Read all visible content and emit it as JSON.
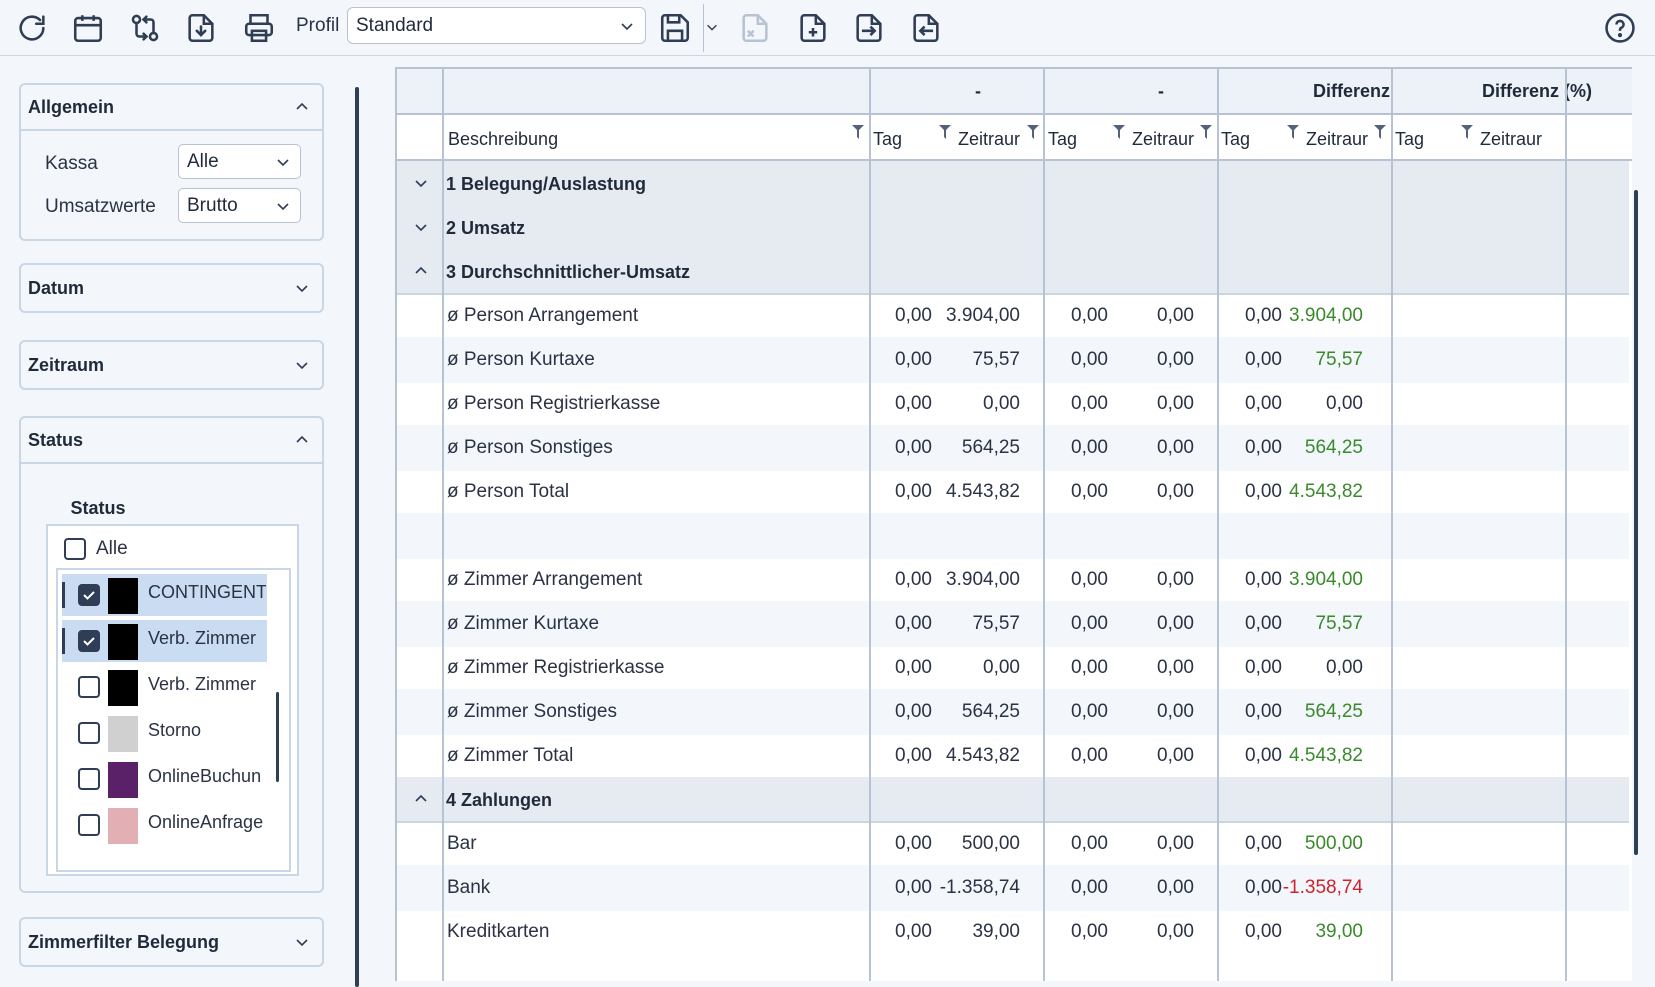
{
  "toolbar": {
    "icons": [
      "refresh-icon",
      "calendar-icon",
      "compare-icon",
      "download-icon",
      "print-icon",
      "save-icon",
      "delete-file-icon",
      "new-file-icon",
      "import-icon",
      "export-icon",
      "help-icon"
    ],
    "profil_label": "Profil",
    "profil_value": "Standard"
  },
  "sidebar": {
    "allgemein": {
      "title": "Allgemein",
      "kassa_label": "Kassa",
      "kassa_value": "Alle",
      "umsatz_label": "Umsatzwerte",
      "umsatz_value": "Brutto"
    },
    "datum_title": "Datum",
    "zeitraum_title": "Zeitraum",
    "status": {
      "title": "Status",
      "tab_label": "Status",
      "alle_label": "Alle",
      "items": [
        {
          "label": "CONTINGENT",
          "checked": true,
          "color": "#000000"
        },
        {
          "label": "Verb. Zimmer",
          "checked": true,
          "color": "#000000"
        },
        {
          "label": "Verb. Zimmer",
          "checked": false,
          "color": "#000000"
        },
        {
          "label": "Storno",
          "checked": false,
          "color": "#d0d0d0"
        },
        {
          "label": "OnlineBuchun",
          "checked": false,
          "color": "#5a2068"
        },
        {
          "label": "OnlineAnfrage",
          "checked": false,
          "color": "#e2b0b4"
        }
      ]
    },
    "zimmerfilter_title": "Zimmerfilter Belegung"
  },
  "grid": {
    "header_groups": [
      "-",
      "-",
      "Differenz",
      "Differenz (%)"
    ],
    "col_desc": "Beschreibung",
    "col_tag": "Tag",
    "col_zeitraum": "Zeitraur",
    "groups": [
      {
        "label": "1 Belegung/Auslastung",
        "expanded": false
      },
      {
        "label": "2 Umsatz",
        "expanded": false
      },
      {
        "label": "3 Durchschnittlicher-Umsatz",
        "expanded": true
      },
      {
        "label": "4 Zahlungen",
        "expanded": true
      }
    ],
    "rows_group3": [
      {
        "desc": "ø Person Arrangement",
        "v": [
          "0,00",
          "3.904,00",
          "0,00",
          "0,00",
          "0,00",
          "3.904,00"
        ]
      },
      {
        "desc": "ø Person Kurtaxe",
        "v": [
          "0,00",
          "75,57",
          "0,00",
          "0,00",
          "0,00",
          "75,57"
        ]
      },
      {
        "desc": "ø Person Registrierkasse",
        "v": [
          "0,00",
          "0,00",
          "0,00",
          "0,00",
          "0,00",
          "0,00"
        ]
      },
      {
        "desc": "ø Person Sonstiges",
        "v": [
          "0,00",
          "564,25",
          "0,00",
          "0,00",
          "0,00",
          "564,25"
        ]
      },
      {
        "desc": "ø Person Total",
        "v": [
          "0,00",
          "4.543,82",
          "0,00",
          "0,00",
          "0,00",
          "4.543,82"
        ]
      },
      {
        "desc": "",
        "v": [
          "",
          "",
          "",
          "",
          "",
          ""
        ]
      },
      {
        "desc": "ø Zimmer Arrangement",
        "v": [
          "0,00",
          "3.904,00",
          "0,00",
          "0,00",
          "0,00",
          "3.904,00"
        ]
      },
      {
        "desc": "ø Zimmer Kurtaxe",
        "v": [
          "0,00",
          "75,57",
          "0,00",
          "0,00",
          "0,00",
          "75,57"
        ]
      },
      {
        "desc": "ø Zimmer Registrierkasse",
        "v": [
          "0,00",
          "0,00",
          "0,00",
          "0,00",
          "0,00",
          "0,00"
        ]
      },
      {
        "desc": "ø Zimmer Sonstiges",
        "v": [
          "0,00",
          "564,25",
          "0,00",
          "0,00",
          "0,00",
          "564,25"
        ]
      },
      {
        "desc": "ø Zimmer Total",
        "v": [
          "0,00",
          "4.543,82",
          "0,00",
          "0,00",
          "0,00",
          "4.543,82"
        ]
      }
    ],
    "rows_group4": [
      {
        "desc": "Bar",
        "v": [
          "0,00",
          "500,00",
          "0,00",
          "0,00",
          "0,00",
          "500,00"
        ]
      },
      {
        "desc": "Bank",
        "v": [
          "0,00",
          "-1.358,74",
          "0,00",
          "0,00",
          "0,00",
          "-1.358,74"
        ]
      },
      {
        "desc": "Kreditkarten",
        "v": [
          "0,00",
          "39,00",
          "0,00",
          "0,00",
          "0,00",
          "39,00"
        ]
      }
    ]
  },
  "colors": {
    "accent": "#2f3d55",
    "positive": "#3a8a2c",
    "negative": "#d0232e"
  }
}
